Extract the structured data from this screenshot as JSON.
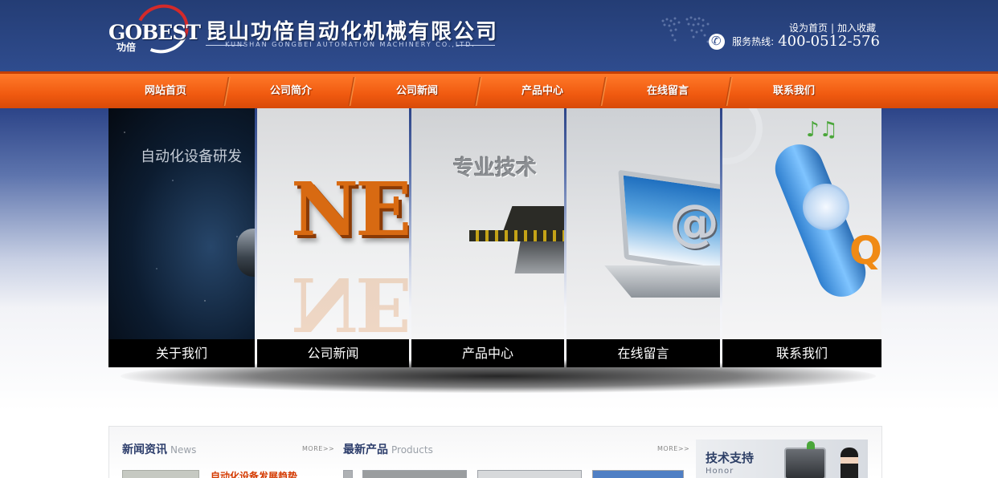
{
  "header": {
    "logo_text": "GOBEST",
    "logo_cn": "功倍",
    "company_name": "昆山功倍自动化机械有限公司",
    "company_en": "KUNSHAN GONGBEI AUTOMATION MACHINERY CO.,LTD.",
    "links": {
      "set_home": "设为首页",
      "separator": "|",
      "bookmark": "加入收藏"
    },
    "hotline_label": "服务热线:",
    "hotline_number": "400-0512-576"
  },
  "nav": {
    "items": [
      {
        "label": "网站首页"
      },
      {
        "label": "公司简介"
      },
      {
        "label": "公司新闻"
      },
      {
        "label": "产品中心"
      },
      {
        "label": "在线留言"
      },
      {
        "label": "联系我们"
      }
    ]
  },
  "banner": {
    "panels": [
      {
        "caption": "关于我们",
        "image_text": "自动化设备研发"
      },
      {
        "caption": "公司新闻",
        "image_text": "NE"
      },
      {
        "caption": "产品中心",
        "image_text": "专业技术"
      },
      {
        "caption": "在线留言",
        "image_text": "@"
      },
      {
        "caption": "联系我们",
        "image_text": "Q"
      }
    ]
  },
  "content": {
    "news": {
      "title": "新闻资讯",
      "title_en": "News",
      "more": "MORE>>",
      "headline": "自动化设备发展趋势"
    },
    "products": {
      "title": "最新产品",
      "title_en": "Products",
      "more": "MORE>>"
    },
    "support": {
      "title": "技术支持",
      "title_en": "Honor"
    }
  },
  "colors": {
    "header_blue": "#2f4c8e",
    "nav_orange": "#f05a10",
    "caption_black": "#000000",
    "headline_red": "#d43a00"
  }
}
